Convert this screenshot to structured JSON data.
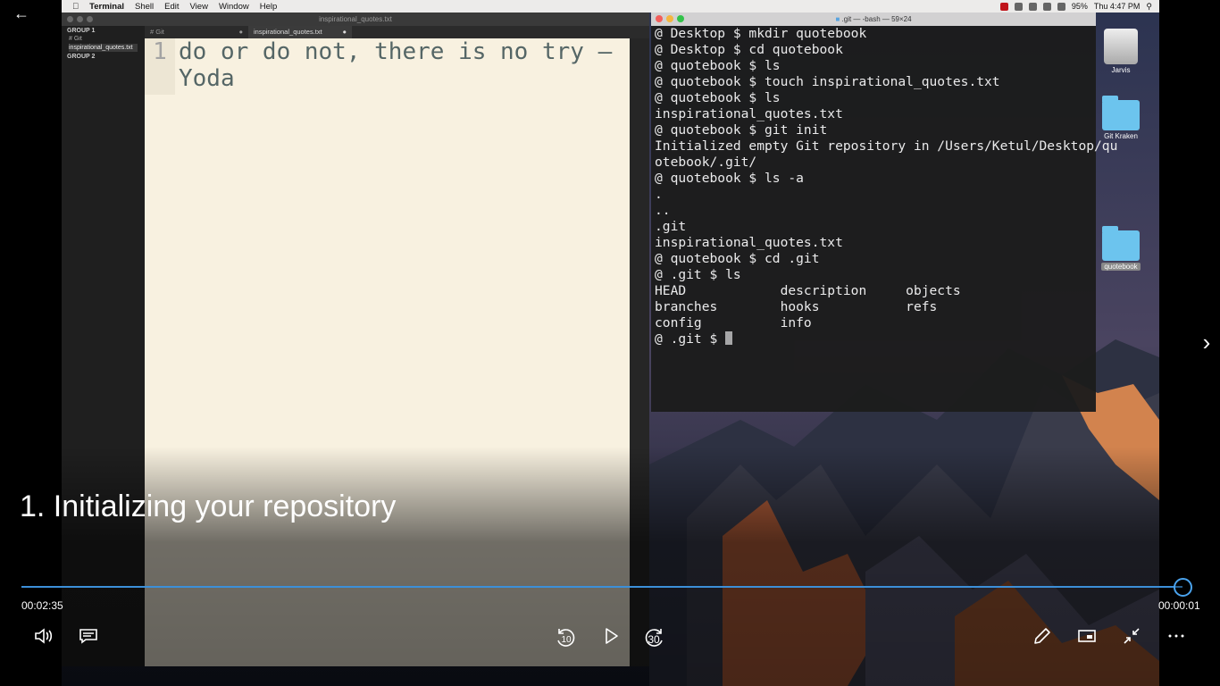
{
  "mac_menubar": {
    "apple": "",
    "items": [
      "Terminal",
      "Shell",
      "Edit",
      "View",
      "Window",
      "Help"
    ],
    "battery": "95%",
    "clock": "Thu 4:47 PM"
  },
  "sublime": {
    "title": "inspirational_quotes.txt",
    "sidebar": {
      "group1": "GROUP 1",
      "items": [
        "# Git",
        "inspirational_quotes.txt"
      ],
      "group2": "GROUP 2"
    },
    "tabs": [
      {
        "label": "# Git",
        "close": "●"
      },
      {
        "label": "inspirational_quotes.txt",
        "close": "●"
      }
    ],
    "line_number": "1",
    "content": "do or do not, there is no try — Yoda"
  },
  "terminal": {
    "title": ".git — -bash — 59×24",
    "lines": [
      "@ Desktop $ mkdir quotebook",
      "@ Desktop $ cd quotebook",
      "@ quotebook $ ls",
      "@ quotebook $ touch inspirational_quotes.txt",
      "@ quotebook $ ls",
      "inspirational_quotes.txt",
      "@ quotebook $ git init",
      "Initialized empty Git repository in /Users/Ketul/Desktop/qu",
      "otebook/.git/",
      "@ quotebook $ ls -a",
      ".",
      "..",
      ".git",
      "inspirational_quotes.txt",
      "@ quotebook $ cd .git",
      "@ .git $ ls",
      "HEAD            description     objects",
      "branches        hooks           refs",
      "config          info"
    ],
    "prompt": "@ .git $ "
  },
  "desktop_icons": [
    {
      "label": "Jarvis"
    },
    {
      "label": "Git Kraken"
    },
    {
      "label": "quotebook"
    }
  ],
  "player": {
    "title": "1. Initializing your repository",
    "elapsed": "00:02:35",
    "remaining": "00:00:01",
    "progress": 0.999,
    "skip_back": "10",
    "skip_forward": "30",
    "accent": "#3c8fd8"
  }
}
